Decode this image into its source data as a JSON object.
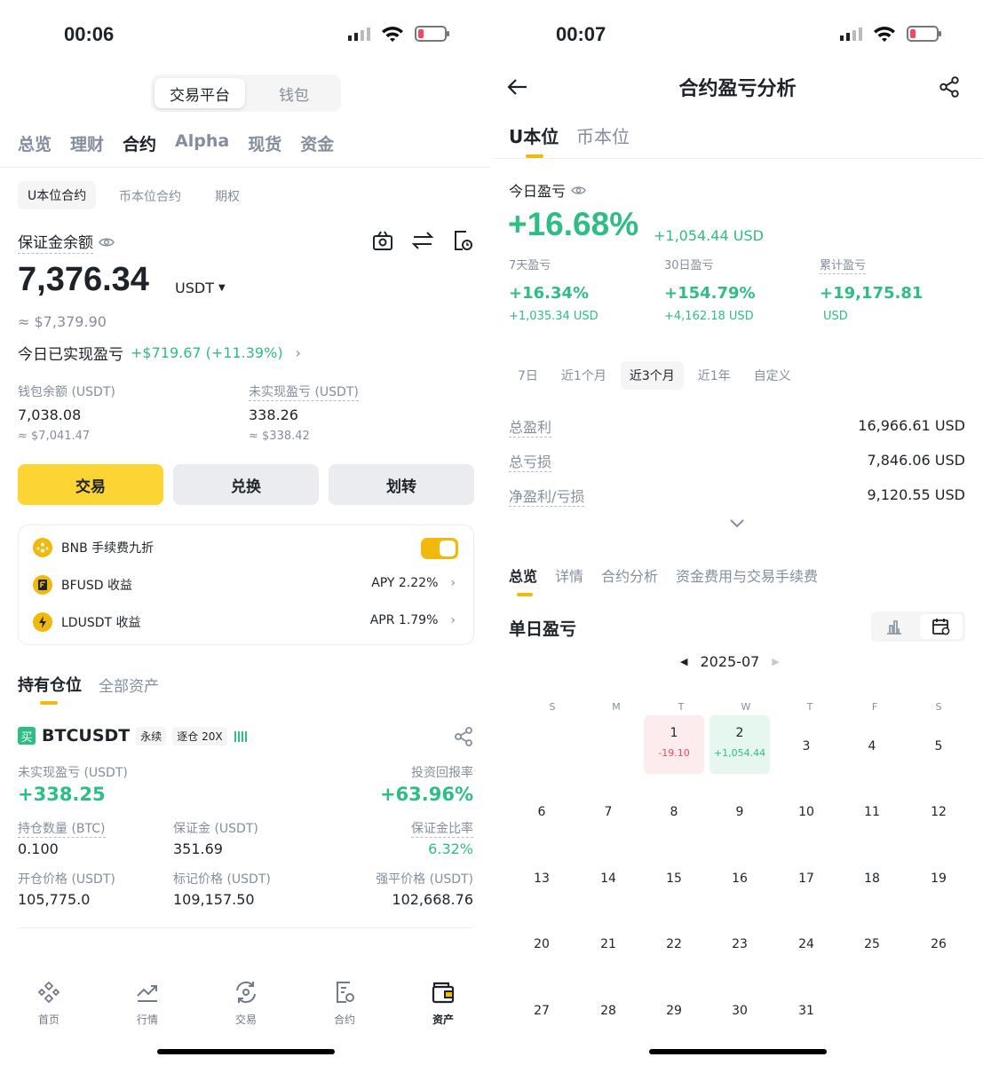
{
  "left": {
    "status_time": "00:06",
    "segment": [
      "交易平台",
      "钱包"
    ],
    "main_tabs": [
      "总览",
      "理财",
      "合约",
      "Alpha",
      "现货",
      "资金"
    ],
    "sub_tabs": [
      "U本位合约",
      "币本位合约",
      "期权"
    ],
    "balance_label": "保证金余额",
    "balance_value": "7,376.34",
    "balance_unit": "USDT",
    "balance_approx": "≈ $7,379.90",
    "today_pnl_label": "今日已实现盈亏",
    "today_pnl_value": "+$719.67 (+11.39%)",
    "wallet_label": "钱包余额 (USDT)",
    "wallet_value": "7,038.08",
    "wallet_approx": "≈ $7,041.47",
    "unrealized_label": "未实现盈亏 (USDT)",
    "unrealized_value": "338.26",
    "unrealized_approx": "≈ $338.42",
    "buttons": [
      "交易",
      "兑换",
      "划转"
    ],
    "promo": [
      {
        "label": "BNB 手续费九折",
        "value": ""
      },
      {
        "label": "BFUSD 收益",
        "value": "APY 2.22%"
      },
      {
        "label": "LDUSDT 收益",
        "value": "APR 1.79%"
      }
    ],
    "holding_tabs": [
      "持有仓位",
      "全部资产"
    ],
    "position": {
      "side": "买",
      "symbol": "BTCUSDT",
      "type": "永续",
      "margin": "逐仓 20X",
      "upnl_label": "未实现盈亏 (USDT)",
      "upnl_value": "+338.25",
      "roi_label": "投资回报率",
      "roi_value": "+63.96%",
      "qty_label": "持仓数量 (BTC)",
      "qty_value": "0.100",
      "margin_label": "保证金 (USDT)",
      "margin_value": "351.69",
      "ratio_label": "保证金比率",
      "ratio_value": "6.32%",
      "entry_label": "开仓价格 (USDT)",
      "entry_value": "105,775.0",
      "mark_label": "标记价格 (USDT)",
      "mark_value": "109,157.50",
      "liq_label": "强平价格 (USDT)",
      "liq_value": "102,668.76"
    },
    "nav": [
      "首页",
      "行情",
      "交易",
      "合约",
      "资产"
    ]
  },
  "right": {
    "status_time": "00:07",
    "title": "合约盈亏分析",
    "tabs": [
      "U本位",
      "币本位"
    ],
    "today_label": "今日盈亏",
    "today_pct": "+16.68%",
    "today_usd": "+1,054.44 USD",
    "stats": [
      {
        "label": "7天盈亏",
        "pct": "+16.34%",
        "usd": "+1,035.34 USD"
      },
      {
        "label": "30日盈亏",
        "pct": "+154.79%",
        "usd": "+4,162.18 USD"
      },
      {
        "label": "累计盈亏",
        "pct": "+19,175.81",
        "usd": "USD"
      }
    ],
    "ranges": [
      "7日",
      "近1个月",
      "近3个月",
      "近1年",
      "自定义"
    ],
    "summary": [
      {
        "label": "总盈利",
        "value": "16,966.61 USD"
      },
      {
        "label": "总亏损",
        "value": "7,846.06 USD"
      },
      {
        "label": "净盈利/亏损",
        "value": "9,120.55 USD"
      }
    ],
    "section_tabs": [
      "总览",
      "详情",
      "合约分析",
      "资金费用与交易手续费"
    ],
    "daily_title": "单日盈亏",
    "month": "2025-07",
    "weekdays": [
      "S",
      "M",
      "T",
      "W",
      "T",
      "F",
      "S"
    ],
    "day_pnl": {
      "1": "-19.10",
      "2": "+1,054.44"
    }
  }
}
